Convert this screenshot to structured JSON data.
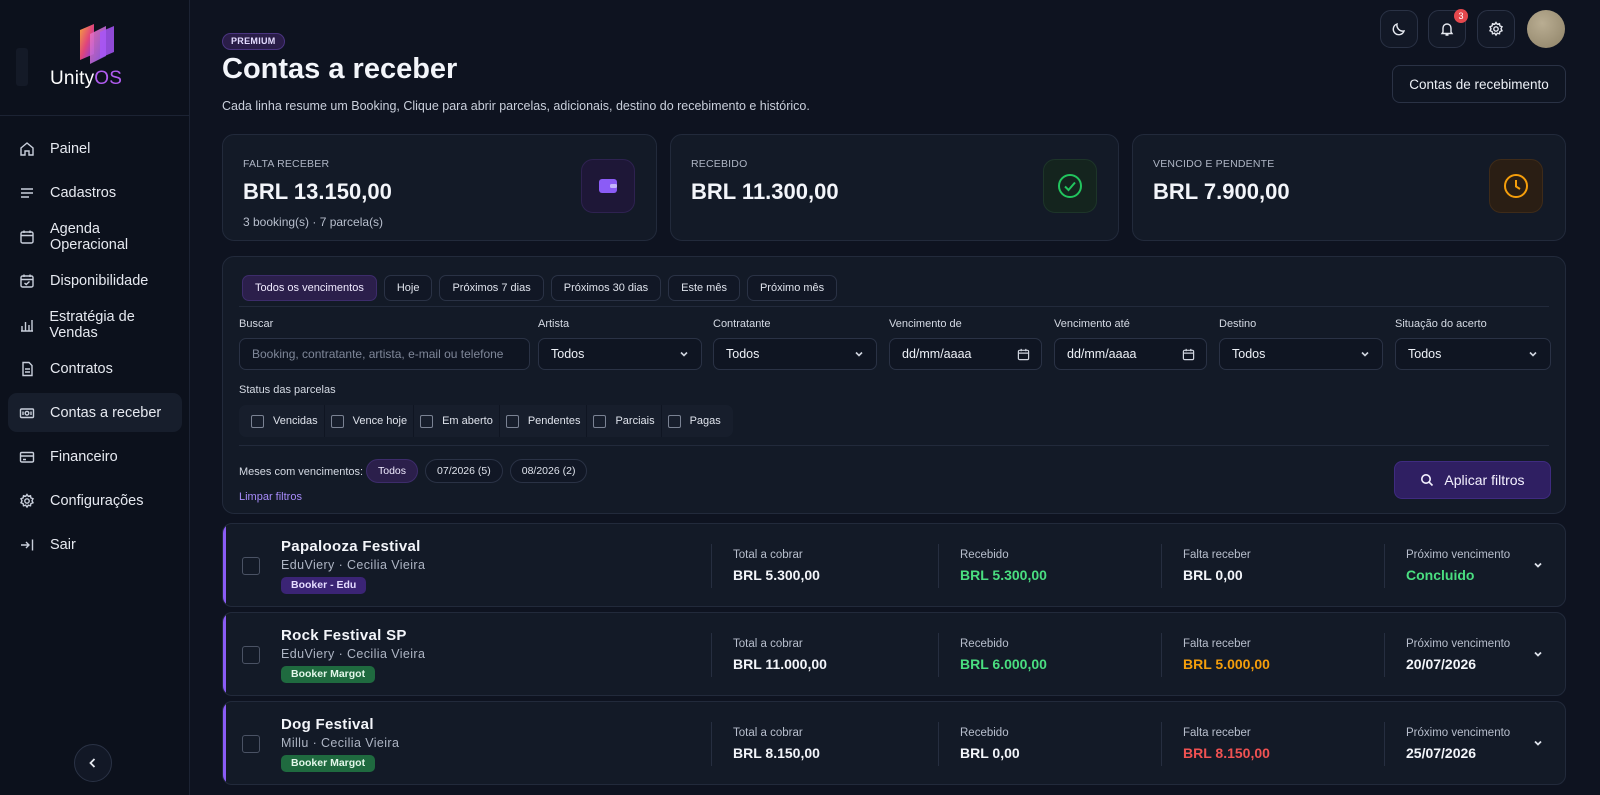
{
  "app": {
    "logo_text_main": "Unity",
    "logo_text_accent": "OS",
    "accent_color": "#8b5cf6"
  },
  "sidebar": {
    "items": [
      {
        "label": "Painel",
        "icon": "home-icon"
      },
      {
        "label": "Cadastros",
        "icon": "list-icon"
      },
      {
        "label": "Agenda Operacional",
        "icon": "calendar-icon"
      },
      {
        "label": "Disponibilidade",
        "icon": "calendar-check-icon"
      },
      {
        "label": "Estratégia de Vendas",
        "icon": "chart-icon"
      },
      {
        "label": "Contratos",
        "icon": "document-icon"
      },
      {
        "label": "Contas a receber",
        "icon": "money-icon",
        "active": true
      },
      {
        "label": "Financeiro",
        "icon": "card-icon"
      },
      {
        "label": "Configurações",
        "icon": "gear-icon"
      },
      {
        "label": "Sair",
        "icon": "logout-icon"
      }
    ]
  },
  "topbar": {
    "notification_count": "3",
    "accounts_button": "Contas de recebimento"
  },
  "header": {
    "badge": "PREMIUM",
    "title": "Contas a receber",
    "subtitle": "Cada linha resume um Booking, Clique para abrir parcelas, adicionais, destino do recebimento e histórico."
  },
  "kpis": [
    {
      "label": "FALTA RECEBER",
      "value": "BRL 13.150,00",
      "note": "3 booking(s) · 7 parcela(s)",
      "icon": "wallet-icon",
      "color": "#8b5cf6"
    },
    {
      "label": "RECEBIDO",
      "value": "BRL 11.300,00",
      "note": "",
      "icon": "check-circle-icon",
      "color": "#22c55e"
    },
    {
      "label": "VENCIDO E PENDENTE",
      "value": "BRL 7.900,00",
      "note": "",
      "icon": "clock-icon",
      "color": "#f59e0b"
    }
  ],
  "filters": {
    "periods": [
      "Todos os vencimentos",
      "Hoje",
      "Próximos 7 dias",
      "Próximos 30 dias",
      "Este mês",
      "Próximo mês"
    ],
    "search": {
      "label": "Buscar",
      "placeholder": "Booking, contratante, artista, e-mail ou telefone"
    },
    "artist": {
      "label": "Artista",
      "value": "Todos"
    },
    "contractor": {
      "label": "Contratante",
      "value": "Todos"
    },
    "due_from": {
      "label": "Vencimento de",
      "value": "dd/mm/aaaa"
    },
    "due_to": {
      "label": "Vencimento até",
      "value": "dd/mm/aaaa"
    },
    "destination": {
      "label": "Destino",
      "value": "Todos"
    },
    "settlement": {
      "label": "Situação do acerto",
      "value": "Todos"
    },
    "status_label": "Status das parcelas",
    "statuses": [
      "Vencidas",
      "Vence hoje",
      "Em aberto",
      "Pendentes",
      "Parciais",
      "Pagas"
    ],
    "months_label": "Meses com vencimentos:",
    "months": [
      "Todos",
      "07/2026 (5)",
      "08/2026 (2)"
    ],
    "clear": "Limpar filtros",
    "apply": "Aplicar filtros"
  },
  "bookings": [
    {
      "name": "Papalooza Festival",
      "sub": "EduViery · Cecilia Vieira",
      "tag": "Booker - Edu",
      "tag_color": "purple",
      "total_label": "Total a cobrar",
      "total": "BRL 5.300,00",
      "received_label": "Recebido",
      "received": "BRL 5.300,00",
      "due_label": "Falta receber",
      "due": "BRL 0,00",
      "next_label": "Próximo vencimento",
      "next": "Concluido"
    },
    {
      "name": "Rock Festival SP",
      "sub": "EduViery · Cecilia Vieira",
      "tag": "Booker Margot",
      "tag_color": "green",
      "total_label": "Total a cobrar",
      "total": "BRL 11.000,00",
      "received_label": "Recebido",
      "received": "BRL 6.000,00",
      "due_label": "Falta receber",
      "due": "BRL 5.000,00",
      "next_label": "Próximo vencimento",
      "next": "20/07/2026"
    },
    {
      "name": "Dog Festival",
      "sub": "Millu · Cecilia Vieira",
      "tag": "Booker Margot",
      "tag_color": "green",
      "total_label": "Total a cobrar",
      "total": "BRL 8.150,00",
      "received_label": "Recebido",
      "received": "BRL 0,00",
      "due_label": "Falta receber",
      "due": "BRL 8.150,00",
      "next_label": "Próximo vencimento",
      "next": "25/07/2026"
    }
  ]
}
